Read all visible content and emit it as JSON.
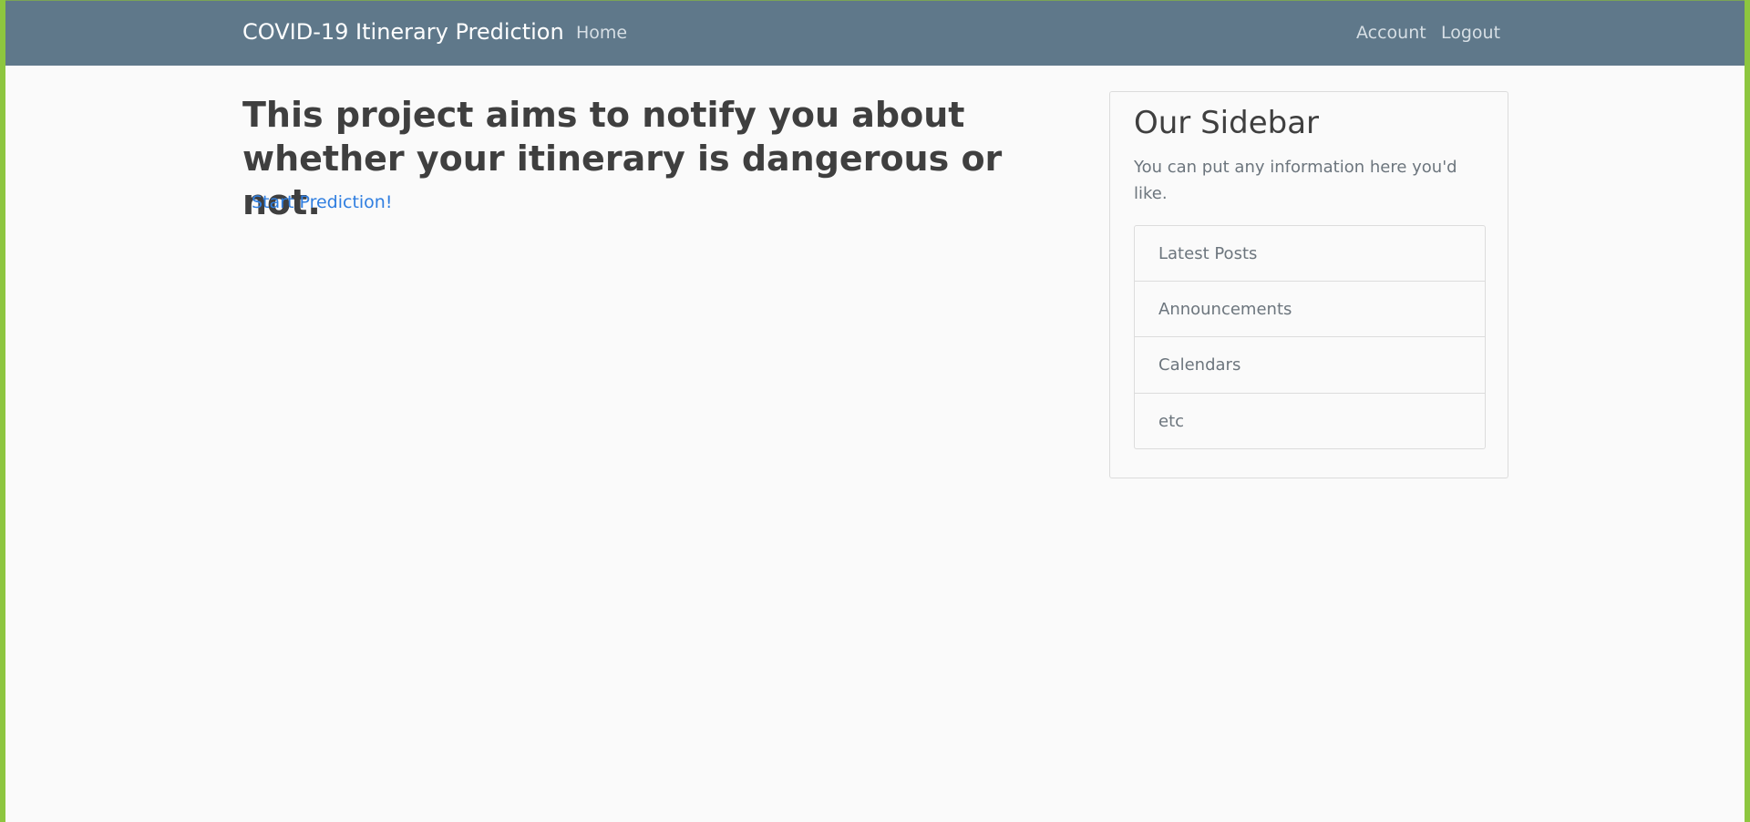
{
  "navbar": {
    "brand": "COVID-19 Itinerary Prediction",
    "home": "Home",
    "account": "Account",
    "logout": "Logout",
    "background_color": "#5f788a"
  },
  "main": {
    "headline": "This project aims to notify you about whether your itinerary is dangerous or not.",
    "start_link": "Start Prediction!",
    "link_color": "#2f7ee0"
  },
  "sidebar": {
    "title": "Our Sidebar",
    "text": "You can put any information here you'd like.",
    "items": [
      {
        "label": "Latest Posts"
      },
      {
        "label": "Announcements"
      },
      {
        "label": "Calendars"
      },
      {
        "label": "etc"
      }
    ]
  },
  "theme": {
    "page_background": "#fafafa",
    "window_border": "#8dc63f"
  }
}
